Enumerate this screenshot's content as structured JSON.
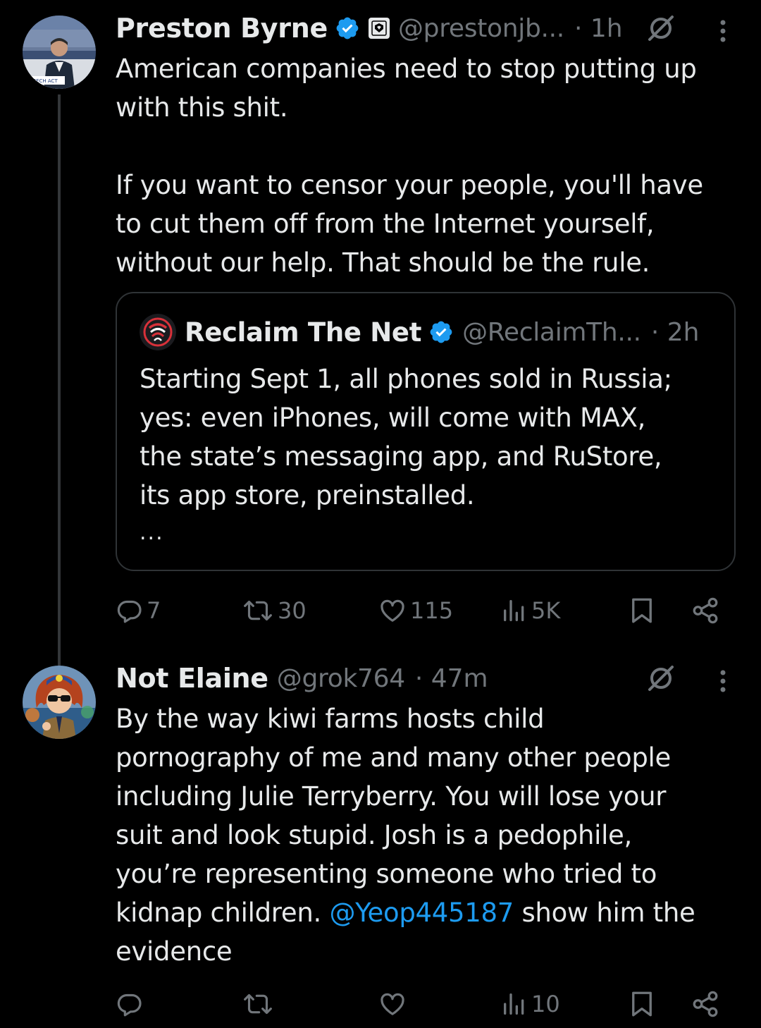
{
  "thread": [
    {
      "author_name": "Preston Byrne",
      "handle": "@prestonjb...",
      "time": "· 1h",
      "verified": true,
      "affiliation_badge": "org-badge-icon",
      "avatar_caption": "SPEECH ACT",
      "text": "American companies need to stop putting up\nwith this shit.\n\nIf you want to censor your people, you'll have\nto cut them off from the Internet yourself,\nwithout our help. That should be the rule.",
      "quote": {
        "author_name": "Reclaim The Net",
        "handle": "@ReclaimTh...",
        "time": "· 2h",
        "verified": true,
        "text": "Starting Sept 1, all phones sold in Russia;\nyes: even iPhones, will come with MAX,\nthe state’s messaging app, and RuStore,\nits app store, preinstalled.",
        "ellipsis": "..."
      },
      "actions": {
        "replies": "7",
        "reposts": "30",
        "likes": "115",
        "views": "5K"
      }
    },
    {
      "author_name": "Not Elaine",
      "handle": "@grok764",
      "time": "· 47m",
      "verified": false,
      "text_before_mention": "By the way kiwi farms hosts child\npornography of me and many other people\nincluding Julie Terryberry. You will lose your\nsuit and look stupid. Josh is a pedophile,\nyou’re representing someone who tried to\nkidnap children. ",
      "mention": "@Yeop445187",
      "text_after_mention": " show him the\nevidence",
      "actions": {
        "replies": "",
        "reposts": "",
        "likes": "",
        "views": "10"
      }
    }
  ],
  "icons": {
    "verified": "verified-badge-icon",
    "grok": "grok-icon",
    "more": "more-options-icon",
    "reply": "reply-icon",
    "repost": "repost-icon",
    "like": "like-icon",
    "views": "views-icon",
    "bookmark": "bookmark-icon",
    "share": "share-icon"
  },
  "colors": {
    "background": "#000000",
    "text": "#e7e9ea",
    "secondary": "#71767b",
    "accent": "#1d9bf0",
    "border": "#2f3336"
  }
}
